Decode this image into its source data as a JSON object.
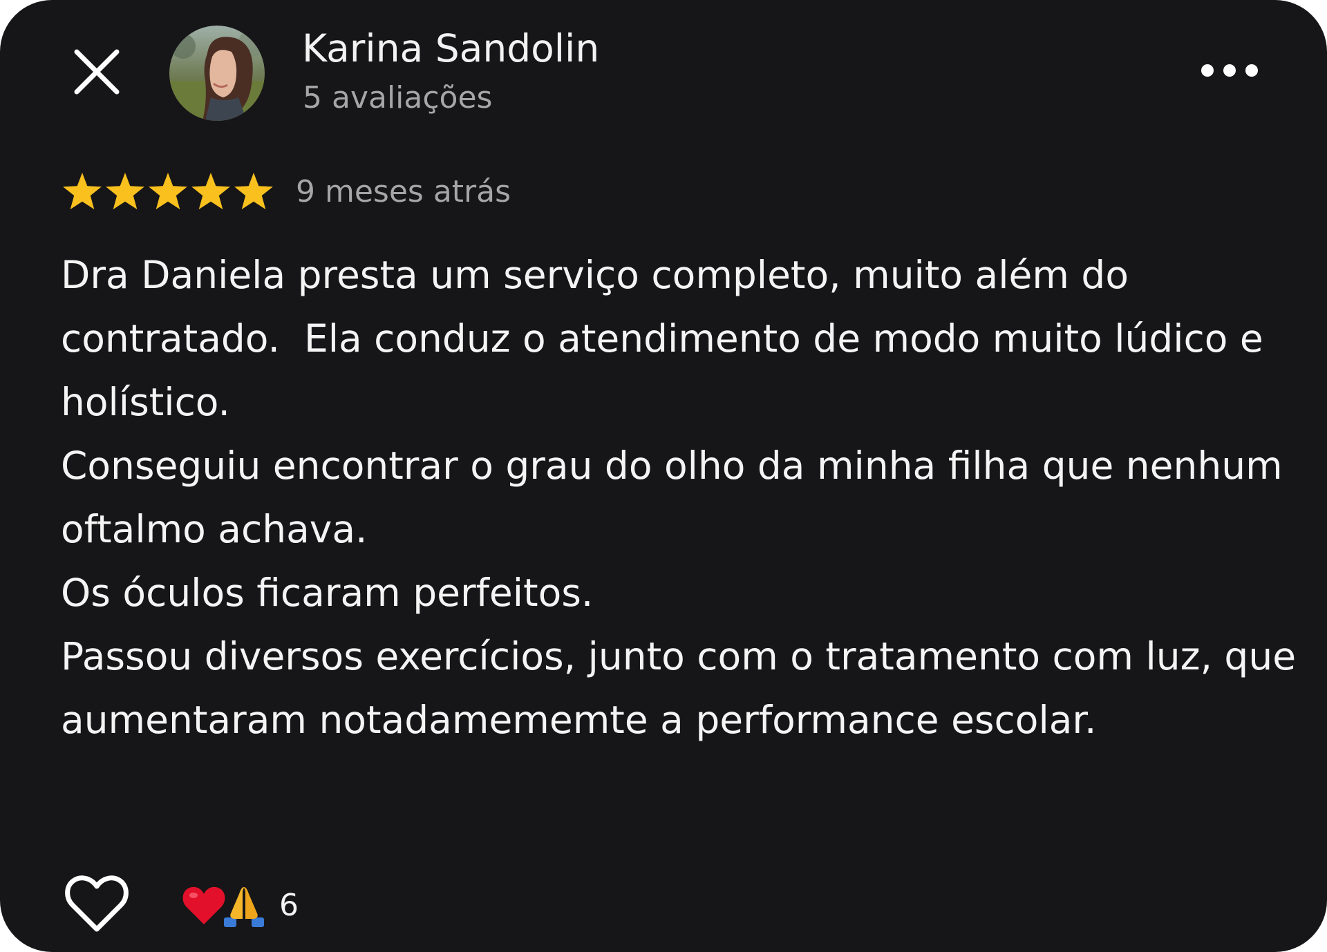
{
  "header": {
    "close_icon": "close-icon",
    "author_name": "Karina Sandolin",
    "review_count": "5 avaliações",
    "more_icon": "more-options-icon"
  },
  "rating": {
    "stars": 5,
    "max_stars": 5,
    "time_ago": "9 meses atrás",
    "star_color": "#F9C01E"
  },
  "review": {
    "paragraphs": [
      "Dra Daniela presta um serviço completo, muito além do contratado.  Ela conduz o atendimento de modo muito lúdico e holístico.",
      "Conseguiu encontrar o grau do olho da minha filha que nenhum oftalmo achava.",
      "Os óculos ficaram perfeitos.",
      "Passou diversos exercícios, junto com o tratamento com luz, que aumentaram notadamememte a performance escolar."
    ]
  },
  "footer": {
    "like_icon": "heart-outline-icon",
    "reactions": [
      "red-heart-icon",
      "folded-hands-icon"
    ],
    "reaction_count": "6"
  },
  "colors": {
    "background": "#161618",
    "text": "#F4F4F4",
    "secondary_text": "#A6A6A8",
    "star": "#F9C01E"
  }
}
